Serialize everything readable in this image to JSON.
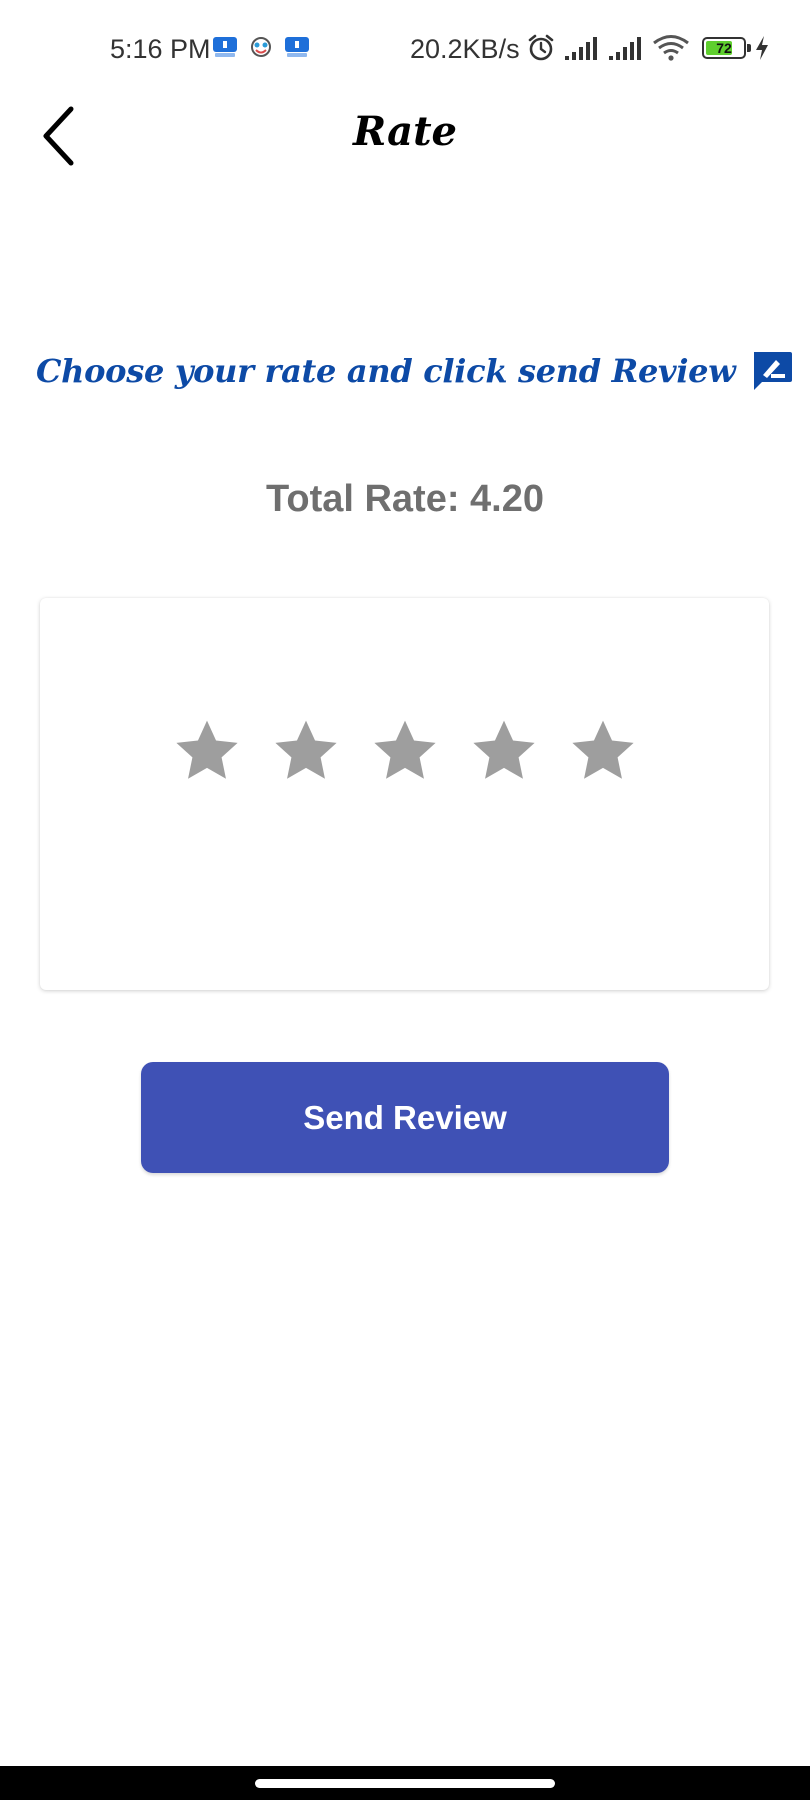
{
  "status_bar": {
    "time": "5:16 PM",
    "net_speed": "20.2KB/s",
    "battery_level": "72",
    "battery_fraction": 0.72,
    "notification_icons": [
      "app-notification-icon",
      "face-app-icon",
      "app-notification-icon"
    ],
    "right_icons": [
      "alarm-icon",
      "signal-icon",
      "signal-icon",
      "wifi-icon",
      "battery-icon",
      "charging-icon"
    ]
  },
  "header": {
    "title": "Rate",
    "back_icon": "chevron-left-icon"
  },
  "instruction": {
    "text": "Choose your rate and click send Review",
    "icon": "rate-review-icon",
    "color": "#0d4aa6"
  },
  "total_rate": {
    "text": "Total Rate: 4.20"
  },
  "rating": {
    "selected": 0,
    "max": 5,
    "star_color": "#9e9e9e"
  },
  "send_button": {
    "label": "Send Review",
    "color": "#3f51b5"
  }
}
